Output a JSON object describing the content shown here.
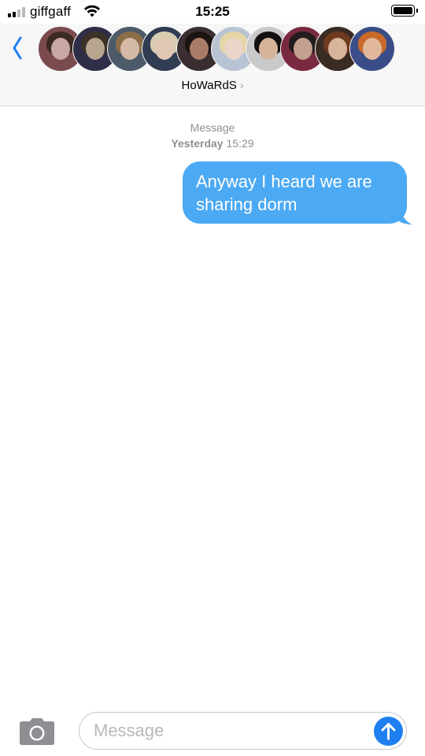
{
  "status_bar": {
    "carrier": "giffgaff",
    "time": "15:25",
    "signal_bars": 4,
    "signal_bars_active": 2,
    "battery_level": 1.0,
    "icons": [
      "signal-icon",
      "wifi-icon",
      "battery-icon"
    ]
  },
  "header": {
    "back_icon": "chevron-left-icon",
    "group_name": "HoWaRdS",
    "group_chevron": "›",
    "participant_count_shown": 10,
    "participants": [
      {
        "avatar_color": "#c9a7a4",
        "hair": "#3b2a24",
        "shirt": "#7a4b4e"
      },
      {
        "avatar_color": "#b8a58e",
        "hair": "#3c3228",
        "shirt": "#2e2e48"
      },
      {
        "avatar_color": "#d4b9a6",
        "hair": "#8b6d48",
        "shirt": "#4d5a6a"
      },
      {
        "avatar_color": "#e0c7b3",
        "hair": "#d8cdb0",
        "shirt": "#2f3c52"
      },
      {
        "avatar_color": "#a87c68",
        "hair": "#1c1410",
        "shirt": "#3a2e30"
      },
      {
        "avatar_color": "#ead6c8",
        "hair": "#e6d6a8",
        "shirt": "#b8c4d4"
      },
      {
        "avatar_color": "#d6b49a",
        "hair": "#141010",
        "shirt": "#c9c9c9"
      },
      {
        "avatar_color": "#c4a090",
        "hair": "#241c1c",
        "shirt": "#7a2a40"
      },
      {
        "avatar_color": "#d8b49c",
        "hair": "#6e3a20",
        "shirt": "#3a2c22"
      },
      {
        "avatar_color": "#e2b89c",
        "hair": "#c96a2a",
        "shirt": "#3b4d88"
      }
    ]
  },
  "thread": {
    "timestamp_label": "Message",
    "timestamp_day": "Yesterday",
    "timestamp_time": "15:29",
    "messages": [
      {
        "direction": "outgoing",
        "text": "Anyway I heard we are sharing dorm",
        "bubble_color": "#4ca9f3"
      }
    ]
  },
  "input": {
    "placeholder": "Message",
    "value": "",
    "camera_icon": "camera-icon",
    "send_icon": "arrow-up-icon",
    "send_color": "#1d7ff0"
  },
  "colors": {
    "accent": "#1d7ff0",
    "header_bg": "#f7f7f7",
    "timestamp": "#8e8e93"
  }
}
